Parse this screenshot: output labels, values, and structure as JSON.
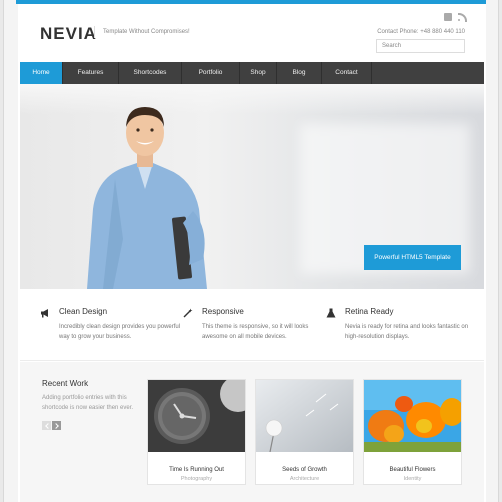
{
  "header": {
    "logo": "NEVIA",
    "tagline": "Template Without Compromises!",
    "contact": "Contact Phone: +48 880 440 110",
    "search_placeholder": "Search",
    "social_icons": [
      "square-icon",
      "rss-icon"
    ]
  },
  "nav": {
    "items": [
      "Home",
      "Features",
      "Shortcodes",
      "Portfolio",
      "Shop",
      "Blog",
      "Contact"
    ],
    "active": "Home"
  },
  "hero": {
    "cta_label": "Powerful HTML5 Template"
  },
  "features": [
    {
      "icon": "megaphone-icon",
      "title": "Clean Design",
      "text": "Incredibly clean design provides you powerful way to grow your business."
    },
    {
      "icon": "magic-wand-icon",
      "title": "Responsive",
      "text": "This theme is responsive, so it will looks awesome on all mobile devices."
    },
    {
      "icon": "flask-icon",
      "title": "Retina Ready",
      "text": "Nevia is ready for retina and looks fantastic on high-resolution displays."
    }
  ],
  "recent_work": {
    "title": "Recent Work",
    "text": "Adding portfolio entries with this shortcode is now easier then ever.",
    "items": [
      {
        "title": "Time Is Running Out",
        "category": "Photography"
      },
      {
        "title": "Seeds of Growth",
        "category": "Architecture"
      },
      {
        "title": "Beautiful Flowers",
        "category": "Identity"
      }
    ]
  },
  "colors": {
    "accent": "#1e9bd7",
    "nav_bg": "#404040"
  }
}
